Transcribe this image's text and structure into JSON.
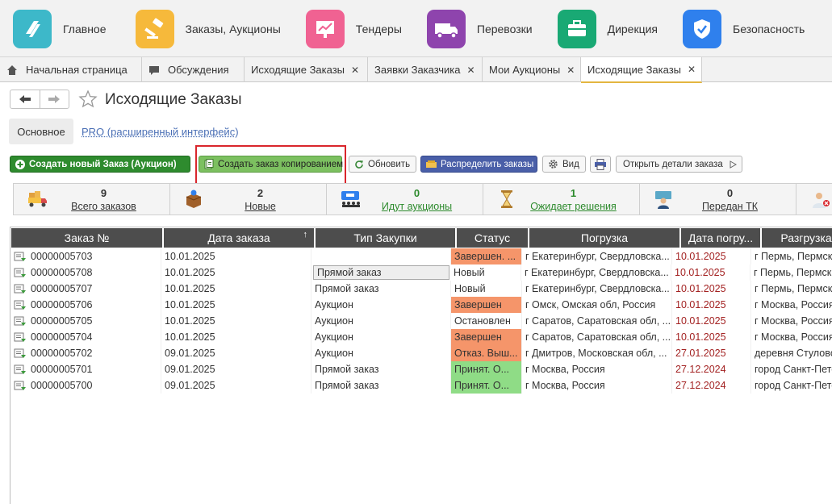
{
  "sections": [
    {
      "label": "Главное",
      "icon": "home-logo-icon",
      "color": "#3db8c9"
    },
    {
      "label": "Заказы, Аукционы",
      "icon": "auction-hammer-icon",
      "color": "#f6b93b"
    },
    {
      "label": "Тендеры",
      "icon": "chart-board-icon",
      "color": "#f06292"
    },
    {
      "label": "Перевозки",
      "icon": "truck-icon",
      "color": "#8e44ad"
    },
    {
      "label": "Дирекция",
      "icon": "briefcase-icon",
      "color": "#19a974"
    },
    {
      "label": "Безопасность",
      "icon": "shield-check-icon",
      "color": "#2f80ed"
    },
    {
      "label": "",
      "icon": "calculator-icon",
      "color": "#c2185b"
    }
  ],
  "tabs": [
    {
      "label": "Начальная страница",
      "icon": "home-icon",
      "closable": false,
      "active": false
    },
    {
      "label": "Обсуждения",
      "icon": "chat-icon",
      "closable": false,
      "active": false
    },
    {
      "label": "Исходящие Заказы",
      "closable": true,
      "active": false
    },
    {
      "label": "Заявки Заказчика",
      "closable": true,
      "active": false
    },
    {
      "label": "Мои Аукционы",
      "closable": true,
      "active": false
    },
    {
      "label": "Исходящие Заказы",
      "closable": true,
      "active": true
    }
  ],
  "page": {
    "title": "Исходящие Заказы"
  },
  "modes": {
    "basic": "Основное",
    "pro": "PRO (расширенный интерфейс)"
  },
  "toolbar": {
    "create_new": "Создать новый Заказ (Аукцион)",
    "create_copy": "Создать заказ копированием",
    "refresh": "Обновить",
    "distribute": "Распределить заказы",
    "view": "Вид",
    "open_details": "Открыть детали заказа"
  },
  "counters": [
    {
      "value": "9",
      "label": "Всего заказов",
      "icon": "truck-boxes-icon",
      "green": false
    },
    {
      "value": "2",
      "label": "Новые",
      "icon": "new-box-icon",
      "green": false
    },
    {
      "value": "0",
      "label": "Идут аукционы",
      "icon": "auction-people-icon",
      "green": true
    },
    {
      "value": "1",
      "label": "Ожидает решения",
      "icon": "hourglass-icon",
      "green": true
    },
    {
      "value": "0",
      "label": "Передан ТК",
      "icon": "handover-person-icon",
      "green": false
    },
    {
      "value": "",
      "label": "",
      "icon": "doctor-person-icon",
      "green": false
    }
  ],
  "table": {
    "columns": [
      "Заказ №",
      "Дата заказа",
      "Тип Закупки",
      "Статус",
      "Погрузка",
      "Дата погру...",
      "Разгрузка"
    ],
    "sort_indicator": "↑",
    "rows": [
      {
        "order": "00000005703",
        "date": "10.01.2025",
        "type": "",
        "status": "Завершен. ...",
        "status_color": "orange",
        "load": "г Екатеринбург, Свердловска...",
        "load_date": "10.01.2025",
        "unload": "г Пермь,  Пермская"
      },
      {
        "order": "00000005708",
        "date": "10.01.2025",
        "type": "Прямой заказ",
        "status": "Новый",
        "status_color": "",
        "load": "г Екатеринбург, Свердловска...",
        "load_date": "10.01.2025",
        "unload": "г Пермь,  Пермская",
        "selected": true
      },
      {
        "order": "00000005707",
        "date": "10.01.2025",
        "type": "Прямой заказ",
        "status": "Новый",
        "status_color": "",
        "load": "г Екатеринбург, Свердловска...",
        "load_date": "10.01.2025",
        "unload": "г Пермь,  Пермская"
      },
      {
        "order": "00000005706",
        "date": "10.01.2025",
        "type": "Аукцион",
        "status": "Завершен",
        "status_color": "orange",
        "load": "г Омск, Омская обл, Россия",
        "load_date": "10.01.2025",
        "unload": "г Москва, Россия"
      },
      {
        "order": "00000005705",
        "date": "10.01.2025",
        "type": "Аукцион",
        "status": "Остановлен",
        "status_color": "",
        "load": "г Саратов, Саратовская обл, ...",
        "load_date": "10.01.2025",
        "unload": "г Москва, Россия"
      },
      {
        "order": "00000005704",
        "date": "10.01.2025",
        "type": "Аукцион",
        "status": "Завершен",
        "status_color": "orange",
        "load": "г Саратов, Саратовская обл, ...",
        "load_date": "10.01.2025",
        "unload": "г Москва, Россия"
      },
      {
        "order": "00000005702",
        "date": "09.01.2025",
        "type": "Аукцион",
        "status": "Отказ. Выш...",
        "status_color": "orange",
        "load": "г Дмитров, Московская обл, ...",
        "load_date": "27.01.2025",
        "unload": "деревня Стуловo"
      },
      {
        "order": "00000005701",
        "date": "09.01.2025",
        "type": "Прямой заказ",
        "status": "Принят. О...",
        "status_color": "green",
        "load": "г Москва, Россия",
        "load_date": "27.12.2024",
        "unload": "город Санкт-Пете"
      },
      {
        "order": "00000005700",
        "date": "09.01.2025",
        "type": "Прямой заказ",
        "status": "Принят. О...",
        "status_color": "green",
        "load": "г Москва, Россия",
        "load_date": "27.12.2024",
        "unload": "город Санкт-Пете"
      }
    ]
  }
}
